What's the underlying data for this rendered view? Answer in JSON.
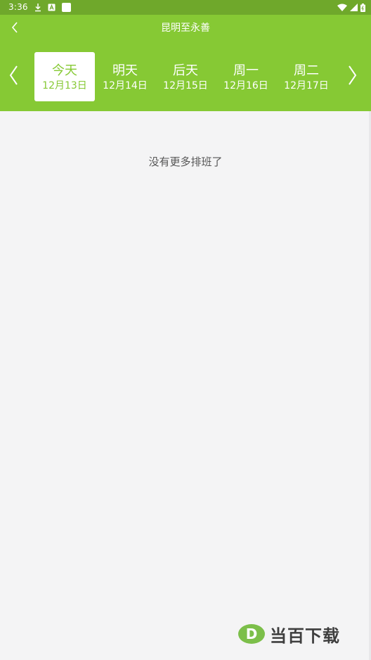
{
  "status_bar": {
    "time": "3:36",
    "icons": [
      "download-icon",
      "a-badge-icon",
      "square-icon",
      "wifi-icon",
      "signal-icon",
      "battery-icon"
    ]
  },
  "header": {
    "title": "昆明至永善",
    "back_icon": "chevron-left-icon",
    "prev_icon": "chevron-left-icon",
    "next_icon": "chevron-right-icon"
  },
  "date_tabs": [
    {
      "day": "今天",
      "date": "12月13日",
      "active": true
    },
    {
      "day": "明天",
      "date": "12月14日",
      "active": false
    },
    {
      "day": "后天",
      "date": "12月15日",
      "active": false
    },
    {
      "day": "周一",
      "date": "12月16日",
      "active": false
    },
    {
      "day": "周二",
      "date": "12月17日",
      "active": false
    }
  ],
  "content": {
    "empty_message": "没有更多排班了"
  },
  "watermark": {
    "letter": "D",
    "text": "当百下载"
  },
  "colors": {
    "status_bar": "#6fa82b",
    "header": "#86c934",
    "background": "#f4f4f5",
    "active_tab_text": "#86c934"
  }
}
